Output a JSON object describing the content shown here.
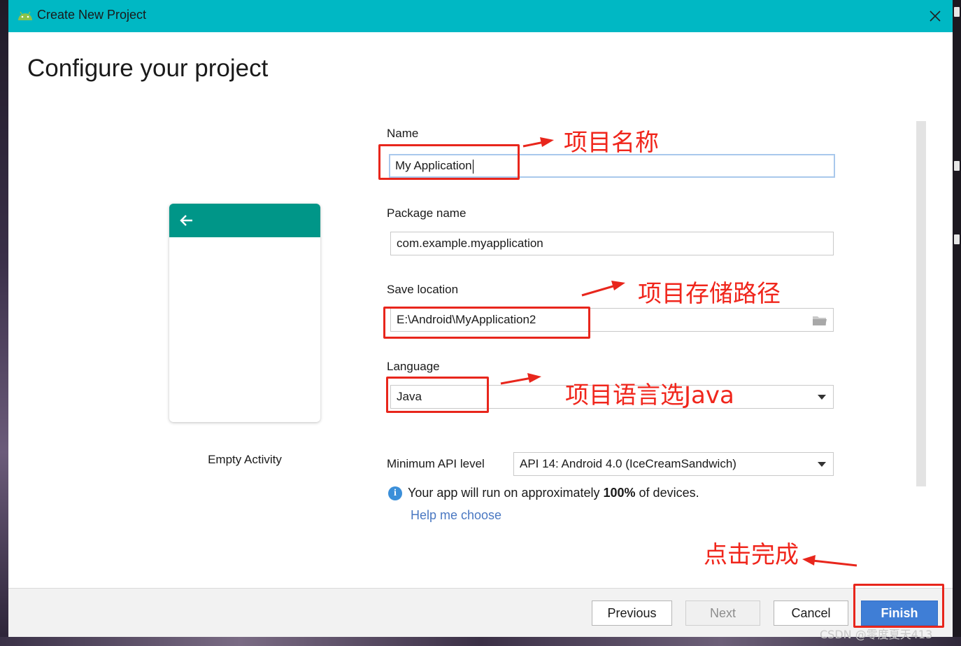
{
  "window": {
    "title": "Create New Project",
    "heading": "Configure your project"
  },
  "preview": {
    "caption": "Empty Activity"
  },
  "form": {
    "name_label": "Name",
    "name_value": "My Application",
    "package_label": "Package name",
    "package_value": "com.example.myapplication",
    "location_label": "Save location",
    "location_value": "E:\\Android\\MyApplication2",
    "language_label": "Language",
    "language_value": "Java",
    "min_api_label": "Minimum API level",
    "min_api_value": "API 14: Android 4.0 (IceCreamSandwich)",
    "info_prefix": "Your app will run on approximately ",
    "info_percent": "100%",
    "info_suffix": " of devices.",
    "help_link": "Help me choose"
  },
  "buttons": {
    "previous": "Previous",
    "next": "Next",
    "cancel": "Cancel",
    "finish": "Finish"
  },
  "annotations": {
    "name": "项目名称",
    "location": "项目存储路径",
    "language": "项目语言选Java",
    "finish": "点击完成"
  },
  "watermark": "CSDN @零度夏天413",
  "colors": {
    "titlebar": "#00b8c4",
    "preview_bar": "#009688",
    "primary_button": "#3f7ed6",
    "annotation": "#e8261c",
    "link": "#4a78c2"
  }
}
